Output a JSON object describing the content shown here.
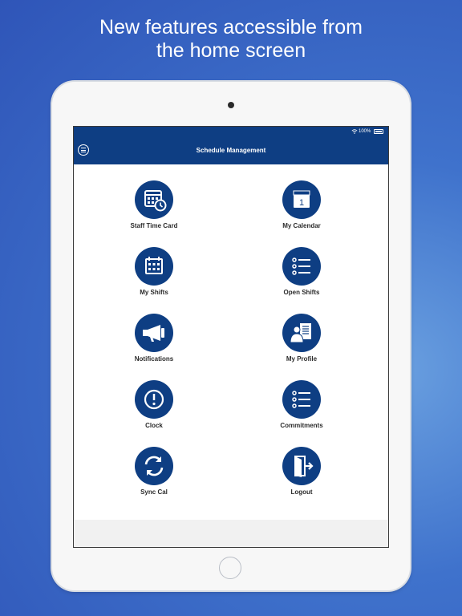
{
  "headline": {
    "line1": "New features accessible from",
    "line2": "the home screen"
  },
  "status_bar": {
    "battery_percent": "100%",
    "icons": [
      "wifi-icon",
      "battery-icon"
    ]
  },
  "nav_bar": {
    "title": "Schedule Management",
    "menu_icon": "menu-icon"
  },
  "tiles": [
    {
      "label": "Staff Time Card",
      "icon": "time-card-icon"
    },
    {
      "label": "My Calendar",
      "icon": "calendar-icon"
    },
    {
      "label": "My Shifts",
      "icon": "shifts-icon"
    },
    {
      "label": "Open Shifts",
      "icon": "list-icon"
    },
    {
      "label": "Notifications",
      "icon": "megaphone-icon"
    },
    {
      "label": "My Profile",
      "icon": "profile-icon"
    },
    {
      "label": "Clock",
      "icon": "clock-alert-icon"
    },
    {
      "label": "Commitments",
      "icon": "list-icon"
    },
    {
      "label": "Sync Cal",
      "icon": "sync-icon"
    },
    {
      "label": "Logout",
      "icon": "logout-icon"
    }
  ],
  "calendar_icon_day": "1",
  "colors": {
    "brand": "#0e3e83",
    "background_top": "#2f55b8",
    "background_highlight": "#6aa0e0"
  }
}
